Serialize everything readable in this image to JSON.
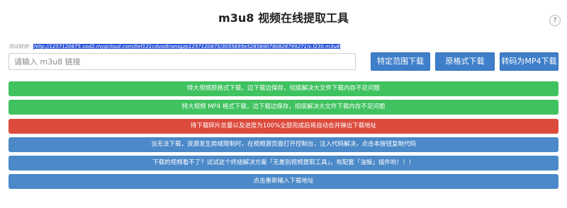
{
  "header": {
    "title": "m3u8 视频在线提取工具",
    "help_label": "?"
  },
  "test": {
    "label": "测试链接：",
    "url": "http://1257120875.vod2.myqcloud.com/0ef121cdvodtransgzp1257120875/3055695e5285890780828799271/v.f230.m3u8"
  },
  "input": {
    "placeholder": "请输入 m3u8 链接",
    "value": ""
  },
  "buttons": {
    "range_download": "特定范围下载",
    "original_download": "原格式下载",
    "convert_mp4": "转码为MP4下载"
  },
  "bars": [
    {
      "text": "特大视频原格式下载，边下载边保存，彻底解决大文件下载内存不足问题",
      "color": "#3fc25f"
    },
    {
      "text": "特大视频 MP4 格式下载，边下载边保存，彻底解决大文件下载内存不足问题",
      "color": "#3fc25f"
    },
    {
      "text": "待下载碎片总量以及进度为100%全部完成后将自动合并弹出下载地址",
      "color": "#dc4a3c"
    },
    {
      "text": "当无法下载，资源发生跨域限制时，在视频源页面打开控制台，注入代码解决，点击本按钮复制代码",
      "color": "#4b89c8"
    },
    {
      "text": "下载的视频看不了？试试这个终结解决方案「无差别视频提取工具」，有配套「油猴」插件哟！！！",
      "color": "#4b89c8"
    },
    {
      "text": "点击重新输入下载地址",
      "color": "#4b89c8"
    }
  ]
}
